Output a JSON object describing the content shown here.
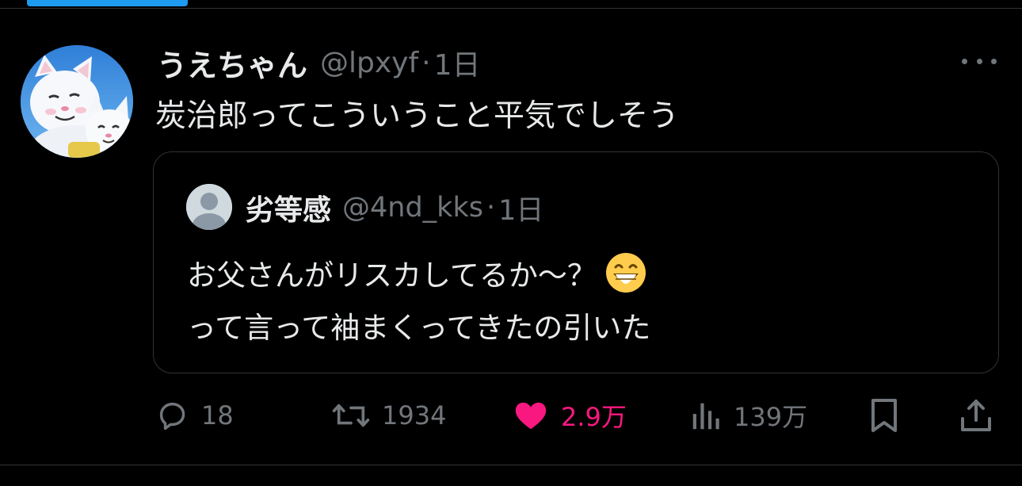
{
  "tweet": {
    "display_name": "うえちゃん",
    "handle": "@lpxyf",
    "separator": "·",
    "time": "1日",
    "text": "炭治郎ってこういうこと平気でしそう"
  },
  "quote": {
    "display_name": "劣等感",
    "handle": "@4nd_kks",
    "separator": "·",
    "time": "1日",
    "line1": "お父さんがリスカしてるか〜？",
    "line2": "って言って袖まくってきたの引いた",
    "emoji_icon": "grinning-face-with-smiling-eyes-emoji"
  },
  "actions": {
    "reply_count": "18",
    "retweet_count": "1934",
    "like_count": "2.9万",
    "views_count": "139万"
  },
  "colors": {
    "accent": "#1d9bf0",
    "like": "#f91880",
    "secondary_text": "#71767b",
    "border": "#2f3336"
  }
}
